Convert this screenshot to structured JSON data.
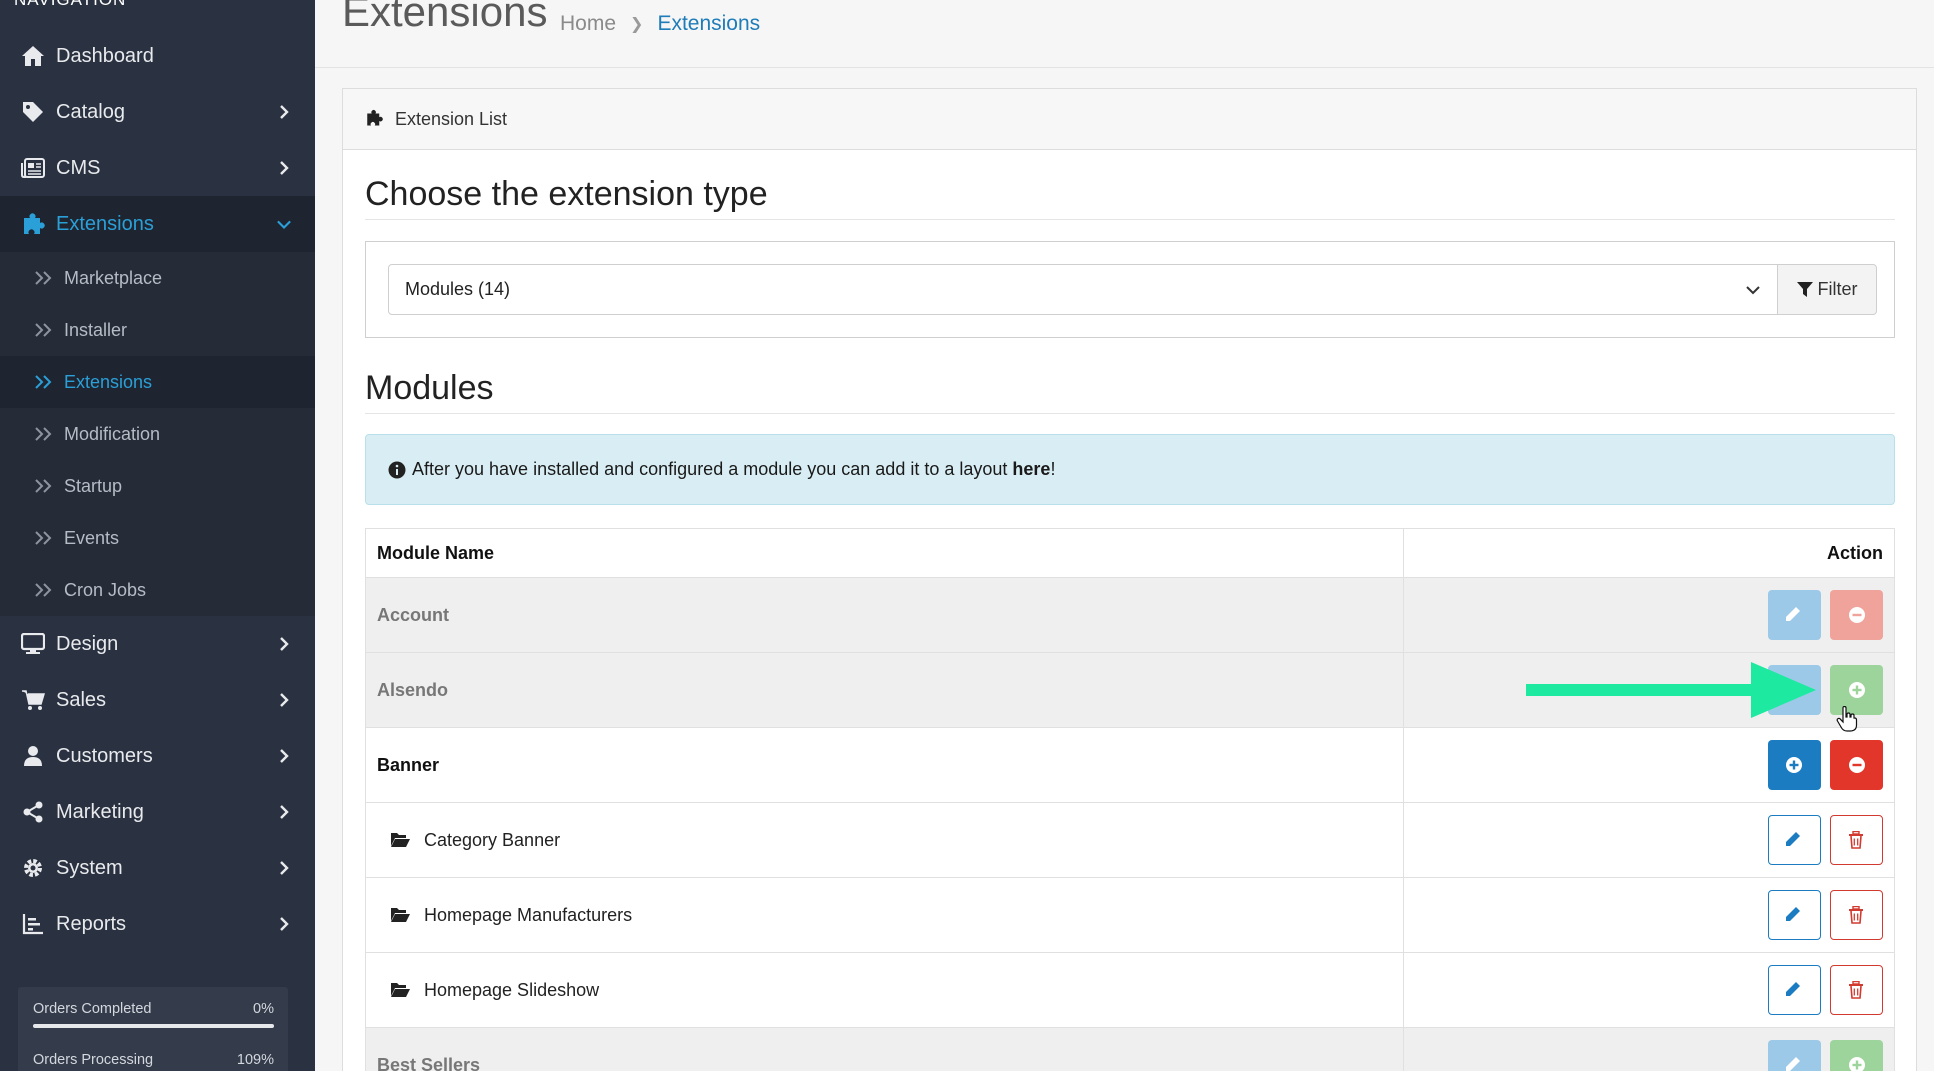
{
  "sidebar": {
    "header": "NAVIGATION",
    "items": [
      {
        "label": "Dashboard",
        "icon": "home-icon"
      },
      {
        "label": "Catalog",
        "icon": "tag-icon"
      },
      {
        "label": "CMS",
        "icon": "newspaper-icon"
      },
      {
        "label": "Extensions",
        "icon": "puzzle-icon"
      },
      {
        "label": "Design",
        "icon": "monitor-icon"
      },
      {
        "label": "Sales",
        "icon": "cart-icon"
      },
      {
        "label": "Customers",
        "icon": "user-icon"
      },
      {
        "label": "Marketing",
        "icon": "share-icon"
      },
      {
        "label": "System",
        "icon": "gear-icon"
      },
      {
        "label": "Reports",
        "icon": "bar-chart-icon"
      }
    ],
    "extensions_sub": [
      "Marketplace",
      "Installer",
      "Extensions",
      "Modification",
      "Startup",
      "Events",
      "Cron Jobs"
    ],
    "stats": [
      {
        "label": "Orders Completed",
        "value": "0%"
      },
      {
        "label": "Orders Processing",
        "value": "109%"
      }
    ]
  },
  "header": {
    "title": "Extensions",
    "breadcrumb": [
      "Home",
      "Extensions"
    ]
  },
  "card": {
    "title": "Extension List",
    "choose_title": "Choose the extension type",
    "select_value": "Modules (14)",
    "filter_label": "Filter",
    "modules_title": "Modules",
    "alert_text": "After you have installed and configured a module you can add it to a layout ",
    "alert_link": "here",
    "alert_end": "!"
  },
  "table": {
    "headers": [
      "Module Name",
      "Action"
    ],
    "rows": [
      {
        "name": "Account",
        "state": "inactive"
      },
      {
        "name": "Alsendo",
        "state": "inactive"
      },
      {
        "name": "Banner",
        "state": "parent"
      },
      {
        "name": "Category Banner",
        "state": "child"
      },
      {
        "name": "Homepage Manufacturers",
        "state": "child"
      },
      {
        "name": "Homepage Slideshow",
        "state": "child"
      },
      {
        "name": "Best Sellers",
        "state": "inactive"
      }
    ]
  },
  "colors": {
    "sidebar": "#2a3140",
    "accent": "#2a9fd8",
    "primary": "#1c7cc2",
    "danger": "#e2362a",
    "annotation": "#1de9a0"
  }
}
